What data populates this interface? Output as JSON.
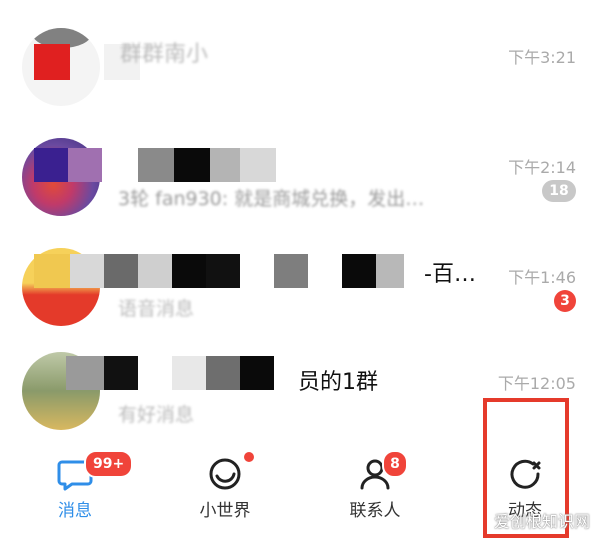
{
  "chats": [
    {
      "title": "群群南小",
      "preview": "",
      "time": "下午3:21",
      "badge": ""
    },
    {
      "title": "",
      "preview": "3轮 fan930: 就是商城兑换，发出…",
      "time": "下午2:14",
      "badge": "18"
    },
    {
      "title": "-百…",
      "preview": "语音消息",
      "time": "下午1:46",
      "badge": "3"
    },
    {
      "title": "员的1群",
      "preview": "有好消息",
      "time": "下午12:05",
      "badge": ""
    }
  ],
  "tabbar": {
    "tabs": [
      {
        "label": "消息",
        "icon": "message-icon",
        "badge": "99+"
      },
      {
        "label": "小世界",
        "icon": "small-world-icon",
        "badge": ""
      },
      {
        "label": "联系人",
        "icon": "contacts-icon",
        "badge": "8"
      },
      {
        "label": "动态",
        "icon": "dynamic-icon",
        "badge": ""
      }
    ]
  },
  "watermark": "爱创根知识网",
  "colors": {
    "accent": "#2f8ee8",
    "badge_red": "#f0443a",
    "highlight": "#e53a2b",
    "badge_gray": "#c8c8c8"
  }
}
